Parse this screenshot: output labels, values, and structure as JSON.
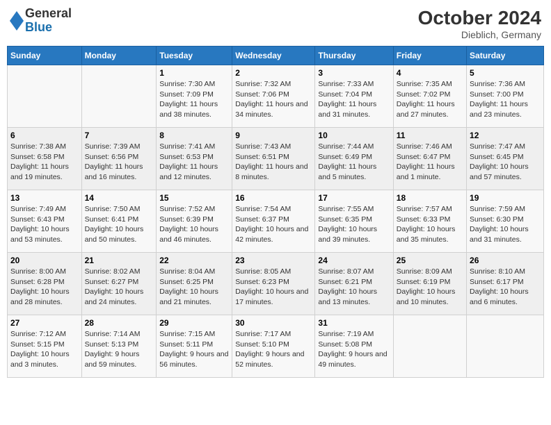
{
  "header": {
    "logo": {
      "general": "General",
      "blue": "Blue"
    },
    "title": "October 2024",
    "location": "Dieblich, Germany"
  },
  "calendar": {
    "weekdays": [
      "Sunday",
      "Monday",
      "Tuesday",
      "Wednesday",
      "Thursday",
      "Friday",
      "Saturday"
    ],
    "weeks": [
      [
        {
          "day": "",
          "info": ""
        },
        {
          "day": "",
          "info": ""
        },
        {
          "day": "1",
          "info": "Sunrise: 7:30 AM\nSunset: 7:09 PM\nDaylight: 11 hours and 38 minutes."
        },
        {
          "day": "2",
          "info": "Sunrise: 7:32 AM\nSunset: 7:06 PM\nDaylight: 11 hours and 34 minutes."
        },
        {
          "day": "3",
          "info": "Sunrise: 7:33 AM\nSunset: 7:04 PM\nDaylight: 11 hours and 31 minutes."
        },
        {
          "day": "4",
          "info": "Sunrise: 7:35 AM\nSunset: 7:02 PM\nDaylight: 11 hours and 27 minutes."
        },
        {
          "day": "5",
          "info": "Sunrise: 7:36 AM\nSunset: 7:00 PM\nDaylight: 11 hours and 23 minutes."
        }
      ],
      [
        {
          "day": "6",
          "info": "Sunrise: 7:38 AM\nSunset: 6:58 PM\nDaylight: 11 hours and 19 minutes."
        },
        {
          "day": "7",
          "info": "Sunrise: 7:39 AM\nSunset: 6:56 PM\nDaylight: 11 hours and 16 minutes."
        },
        {
          "day": "8",
          "info": "Sunrise: 7:41 AM\nSunset: 6:53 PM\nDaylight: 11 hours and 12 minutes."
        },
        {
          "day": "9",
          "info": "Sunrise: 7:43 AM\nSunset: 6:51 PM\nDaylight: 11 hours and 8 minutes."
        },
        {
          "day": "10",
          "info": "Sunrise: 7:44 AM\nSunset: 6:49 PM\nDaylight: 11 hours and 5 minutes."
        },
        {
          "day": "11",
          "info": "Sunrise: 7:46 AM\nSunset: 6:47 PM\nDaylight: 11 hours and 1 minute."
        },
        {
          "day": "12",
          "info": "Sunrise: 7:47 AM\nSunset: 6:45 PM\nDaylight: 10 hours and 57 minutes."
        }
      ],
      [
        {
          "day": "13",
          "info": "Sunrise: 7:49 AM\nSunset: 6:43 PM\nDaylight: 10 hours and 53 minutes."
        },
        {
          "day": "14",
          "info": "Sunrise: 7:50 AM\nSunset: 6:41 PM\nDaylight: 10 hours and 50 minutes."
        },
        {
          "day": "15",
          "info": "Sunrise: 7:52 AM\nSunset: 6:39 PM\nDaylight: 10 hours and 46 minutes."
        },
        {
          "day": "16",
          "info": "Sunrise: 7:54 AM\nSunset: 6:37 PM\nDaylight: 10 hours and 42 minutes."
        },
        {
          "day": "17",
          "info": "Sunrise: 7:55 AM\nSunset: 6:35 PM\nDaylight: 10 hours and 39 minutes."
        },
        {
          "day": "18",
          "info": "Sunrise: 7:57 AM\nSunset: 6:33 PM\nDaylight: 10 hours and 35 minutes."
        },
        {
          "day": "19",
          "info": "Sunrise: 7:59 AM\nSunset: 6:30 PM\nDaylight: 10 hours and 31 minutes."
        }
      ],
      [
        {
          "day": "20",
          "info": "Sunrise: 8:00 AM\nSunset: 6:28 PM\nDaylight: 10 hours and 28 minutes."
        },
        {
          "day": "21",
          "info": "Sunrise: 8:02 AM\nSunset: 6:27 PM\nDaylight: 10 hours and 24 minutes."
        },
        {
          "day": "22",
          "info": "Sunrise: 8:04 AM\nSunset: 6:25 PM\nDaylight: 10 hours and 21 minutes."
        },
        {
          "day": "23",
          "info": "Sunrise: 8:05 AM\nSunset: 6:23 PM\nDaylight: 10 hours and 17 minutes."
        },
        {
          "day": "24",
          "info": "Sunrise: 8:07 AM\nSunset: 6:21 PM\nDaylight: 10 hours and 13 minutes."
        },
        {
          "day": "25",
          "info": "Sunrise: 8:09 AM\nSunset: 6:19 PM\nDaylight: 10 hours and 10 minutes."
        },
        {
          "day": "26",
          "info": "Sunrise: 8:10 AM\nSunset: 6:17 PM\nDaylight: 10 hours and 6 minutes."
        }
      ],
      [
        {
          "day": "27",
          "info": "Sunrise: 7:12 AM\nSunset: 5:15 PM\nDaylight: 10 hours and 3 minutes."
        },
        {
          "day": "28",
          "info": "Sunrise: 7:14 AM\nSunset: 5:13 PM\nDaylight: 9 hours and 59 minutes."
        },
        {
          "day": "29",
          "info": "Sunrise: 7:15 AM\nSunset: 5:11 PM\nDaylight: 9 hours and 56 minutes."
        },
        {
          "day": "30",
          "info": "Sunrise: 7:17 AM\nSunset: 5:10 PM\nDaylight: 9 hours and 52 minutes."
        },
        {
          "day": "31",
          "info": "Sunrise: 7:19 AM\nSunset: 5:08 PM\nDaylight: 9 hours and 49 minutes."
        },
        {
          "day": "",
          "info": ""
        },
        {
          "day": "",
          "info": ""
        }
      ]
    ]
  }
}
